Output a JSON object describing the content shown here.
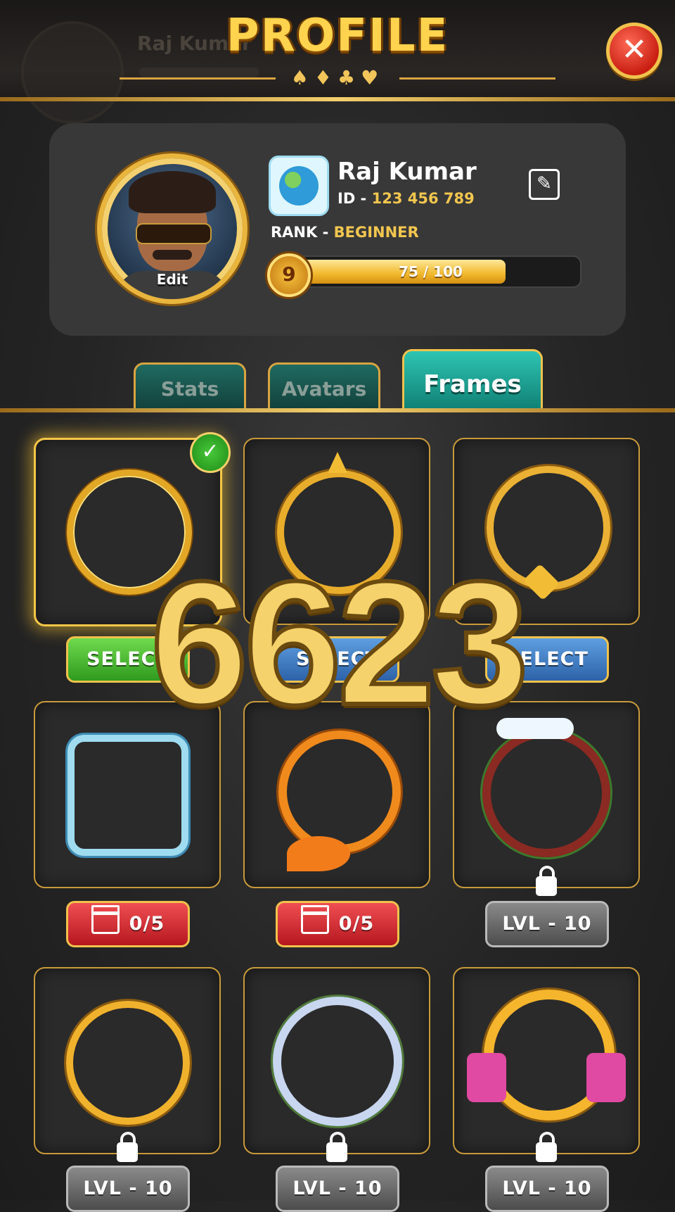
{
  "header": {
    "title": "PROFILE",
    "suits": "♠♦♣♥",
    "close_icon": "close-icon",
    "background_ghost_name": "Raj Kumar"
  },
  "profile": {
    "name": "Raj Kumar",
    "id_label": "ID -",
    "id_value": "123 456 789",
    "rank_label": "RANK -",
    "rank_value": "BEGINNER",
    "level": "9",
    "xp_text": "75 / 100",
    "xp_fraction": 0.75,
    "avatar_edit_label": "Edit",
    "flag_icon": "globe-icon"
  },
  "tabs": [
    {
      "label": "Stats",
      "active": false
    },
    {
      "label": "Avatars",
      "active": false
    },
    {
      "label": "Frames",
      "active": true
    }
  ],
  "frames": [
    {
      "name": "gold-classic-frame",
      "action": "SELECT",
      "style": "green",
      "selected": true,
      "locked": false
    },
    {
      "name": "sun-spike-frame",
      "action": "SELECT",
      "style": "blue",
      "selected": false,
      "locked": false
    },
    {
      "name": "golden-horn-frame",
      "action": "SELECT",
      "style": "blue",
      "selected": false,
      "locked": false
    },
    {
      "name": "ice-crystal-frame",
      "action": "0/5",
      "style": "red",
      "selected": false,
      "locked": false
    },
    {
      "name": "fox-frame",
      "action": "0/5",
      "style": "red",
      "selected": false,
      "locked": false
    },
    {
      "name": "christmas-wreath-frame",
      "action": "LVL - 10",
      "style": "gray",
      "selected": false,
      "locked": true
    },
    {
      "name": "jewel-frame",
      "action": "LVL - 10",
      "style": "gray",
      "selected": false,
      "locked": true
    },
    {
      "name": "floral-frame",
      "action": "LVL - 10",
      "style": "gray",
      "selected": false,
      "locked": true
    },
    {
      "name": "ribbon-frame",
      "action": "LVL - 10",
      "style": "gray",
      "selected": false,
      "locked": true
    }
  ],
  "watermark": "6623",
  "colors": {
    "accent_gold": "#f0c24c",
    "tab_active": "#1aa596",
    "select_green": "#3fb22a",
    "select_blue": "#3b78c2",
    "video_red": "#d22a30",
    "locked_gray": "#6a6a6a"
  }
}
